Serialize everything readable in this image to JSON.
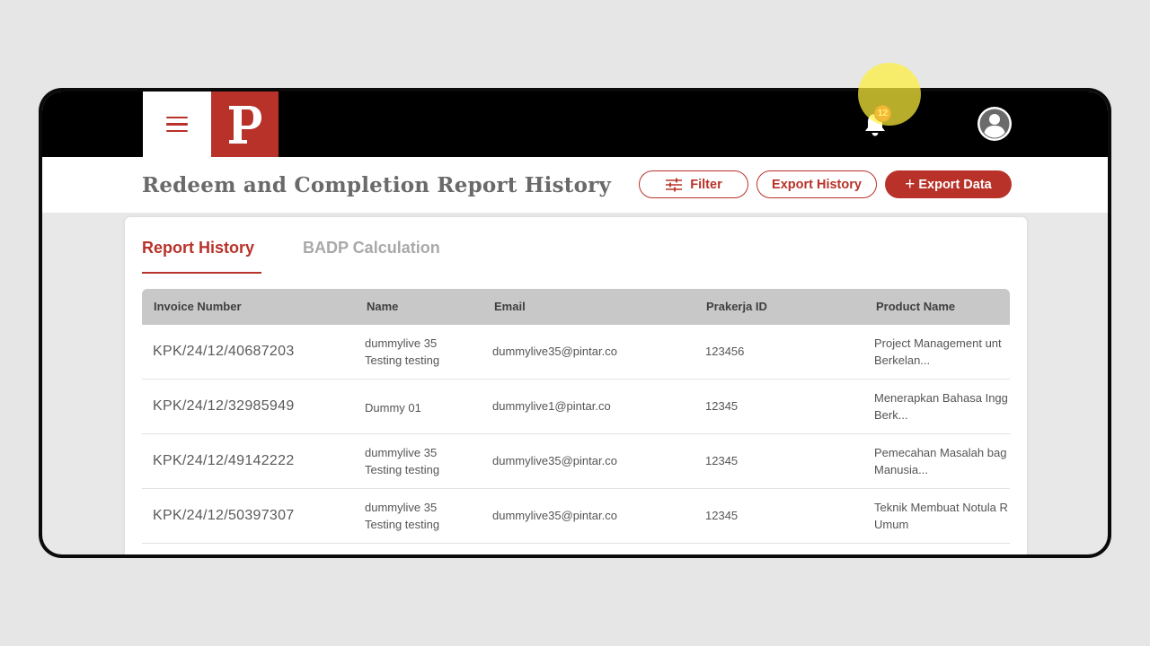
{
  "app": {
    "logo_letter": "P",
    "notification_count": "12"
  },
  "header": {
    "title": "Redeem and Completion Report History",
    "filter_label": "Filter",
    "export_history_label": "Export History",
    "export_data_plus": "+",
    "export_data_label": "Export Data"
  },
  "tabs": [
    {
      "label": "Report History",
      "active": true
    },
    {
      "label": "BADP Calculation",
      "active": false
    }
  ],
  "table": {
    "columns": [
      "Invoice Number",
      "Name",
      "Email",
      "Prakerja ID",
      "Product Name"
    ],
    "rows": [
      {
        "invoice": "KPK/24/12/40687203",
        "name_line1": "dummylive 35",
        "name_line2": "Testing testing",
        "email": "dummylive35@pintar.co",
        "prakerja_id": "123456",
        "product_line1": "Project Management unt",
        "product_line2": "Berkelan..."
      },
      {
        "invoice": "KPK/24/12/32985949",
        "name_line1": "Dummy 01",
        "name_line2": "",
        "email": "dummylive1@pintar.co",
        "prakerja_id": "12345",
        "product_line1": "Menerapkan Bahasa Ingg",
        "product_line2": "Berk..."
      },
      {
        "invoice": "KPK/24/12/49142222",
        "name_line1": "dummylive 35",
        "name_line2": "Testing testing",
        "email": "dummylive35@pintar.co",
        "prakerja_id": "12345",
        "product_line1": "Pemecahan Masalah bag",
        "product_line2": "Manusia..."
      },
      {
        "invoice": "KPK/24/12/50397307",
        "name_line1": "dummylive 35",
        "name_line2": "Testing testing",
        "email": "dummylive35@pintar.co",
        "prakerja_id": "12345",
        "product_line1": "Teknik Membuat Notula R",
        "product_line2": "Umum"
      }
    ]
  },
  "colors": {
    "brand": "#b8322a",
    "topbar": "#000000",
    "header_bg": "#ffffff",
    "table_header_bg": "#c8c8c8",
    "cursor_highlight": "#fff03c"
  },
  "icons": [
    "hamburger-menu-icon",
    "logo-icon",
    "bell-icon",
    "avatar-icon",
    "filter-sliders-icon",
    "plus-icon"
  ]
}
